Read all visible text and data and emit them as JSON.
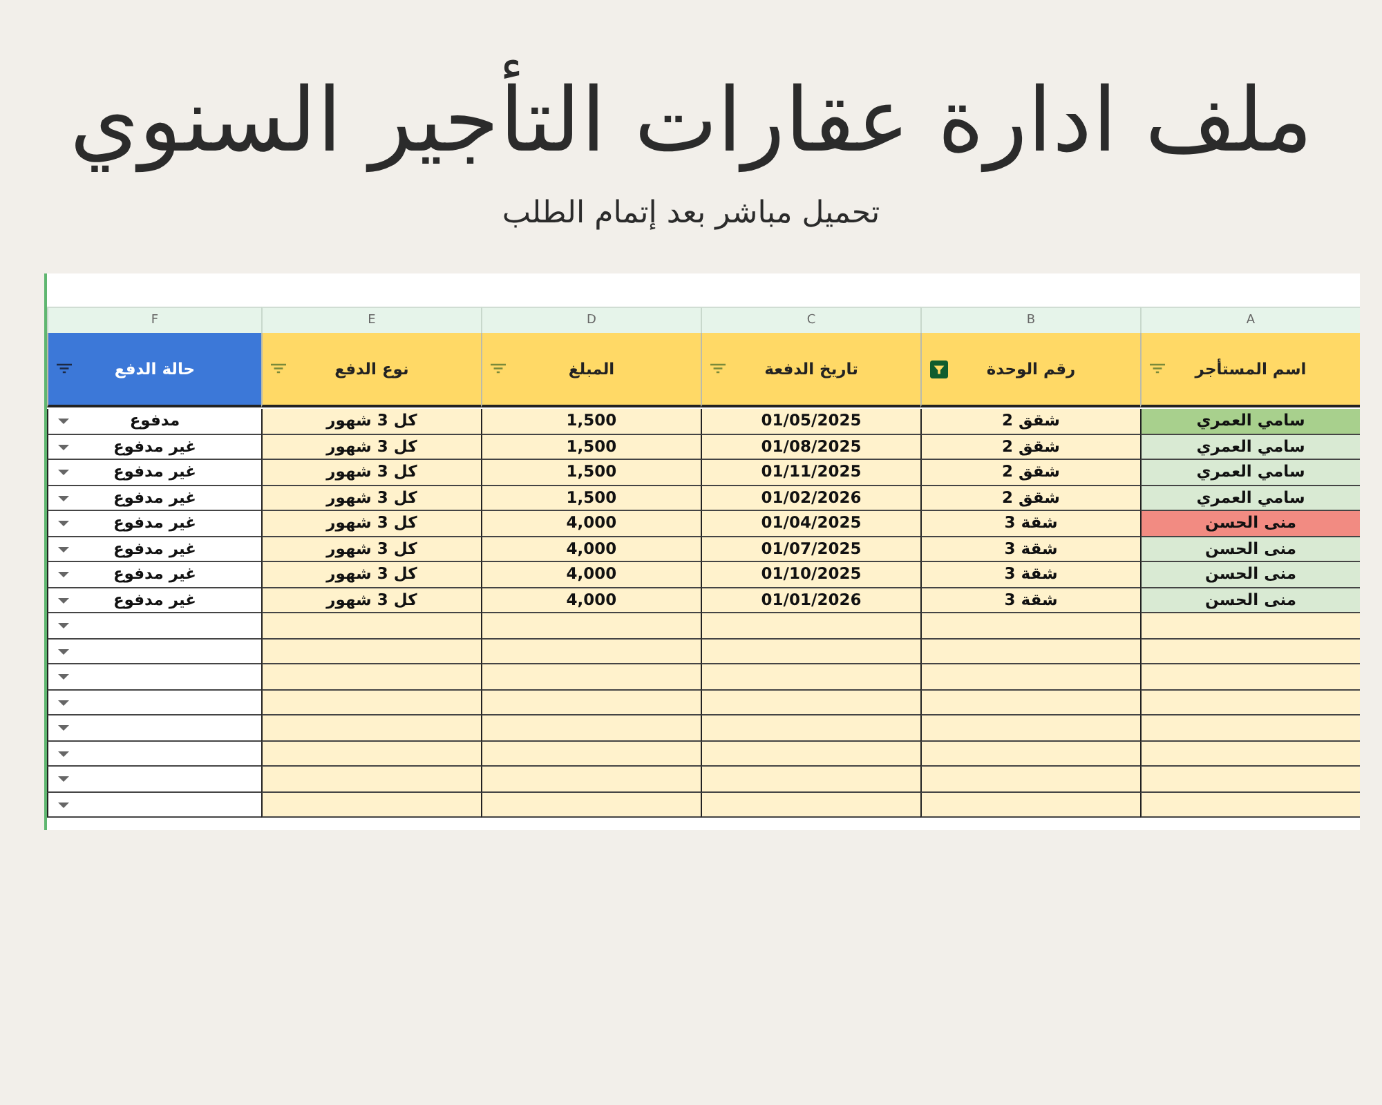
{
  "title": "ملف ادارة عقارات التأجير السنوي",
  "subtitle": "تحميل مباشر بعد إتمام الطلب",
  "sheet": {
    "columns": [
      {
        "letter": "A",
        "header": "اسم المستأجر",
        "color": "#ffd966",
        "filter_active": false
      },
      {
        "letter": "B",
        "header": "رقم الوحدة",
        "color": "#ffd966",
        "filter_active": true
      },
      {
        "letter": "C",
        "header": "تاريخ الدفعة",
        "color": "#ffd966",
        "filter_active": false
      },
      {
        "letter": "D",
        "header": "المبلغ",
        "color": "#ffd966",
        "filter_active": false
      },
      {
        "letter": "E",
        "header": "نوع الدفع",
        "color": "#ffd966",
        "filter_active": false
      },
      {
        "letter": "F",
        "header": "حالة الدفع",
        "color": "#3c78d8",
        "filter_active": false
      }
    ],
    "rows": [
      {
        "kind": "data",
        "tenant": "سامي العمري",
        "color": "#a8d08d",
        "unit": "شقق 2",
        "date": "01/05/2025",
        "amount": "1,500",
        "type": "كل 3 شهور",
        "status": "مدفوع"
      },
      {
        "kind": "data",
        "tenant": "سامي العمري",
        "color": "#d9ead3",
        "unit": "شقق 2",
        "date": "01/08/2025",
        "amount": "1,500",
        "type": "كل 3 شهور",
        "status": "غير مدفوع"
      },
      {
        "kind": "data",
        "tenant": "سامي العمري",
        "color": "#d9ead3",
        "unit": "شقق 2",
        "date": "01/11/2025",
        "amount": "1,500",
        "type": "كل 3 شهور",
        "status": "غير مدفوع"
      },
      {
        "kind": "data",
        "tenant": "سامي العمري",
        "color": "#d9ead3",
        "unit": "شقق 2",
        "date": "01/02/2026",
        "amount": "1,500",
        "type": "كل 3 شهور",
        "status": "غير مدفوع"
      },
      {
        "kind": "data",
        "tenant": "منى الحسن",
        "color": "#f28b82",
        "unit": "شقة 3",
        "date": "01/04/2025",
        "amount": "4,000",
        "type": "كل 3 شهور",
        "status": "غير مدفوع"
      },
      {
        "kind": "data",
        "tenant": "منى الحسن",
        "color": "#d9ead3",
        "unit": "شقة 3",
        "date": "01/07/2025",
        "amount": "4,000",
        "type": "كل 3 شهور",
        "status": "غير مدفوع"
      },
      {
        "kind": "data",
        "tenant": "منى الحسن",
        "color": "#d9ead3",
        "unit": "شقة 3",
        "date": "01/10/2025",
        "amount": "4,000",
        "type": "كل 3 شهور",
        "status": "غير مدفوع"
      },
      {
        "kind": "data",
        "tenant": "منى الحسن",
        "color": "#d9ead3",
        "unit": "شقة 3",
        "date": "01/01/2026",
        "amount": "4,000",
        "type": "كل 3 شهور",
        "status": "غير مدفوع"
      },
      {
        "kind": "blank"
      },
      {
        "kind": "blank"
      },
      {
        "kind": "blank"
      },
      {
        "kind": "blank"
      },
      {
        "kind": "blank"
      },
      {
        "kind": "blank"
      },
      {
        "kind": "blank"
      },
      {
        "kind": "blank"
      }
    ]
  }
}
